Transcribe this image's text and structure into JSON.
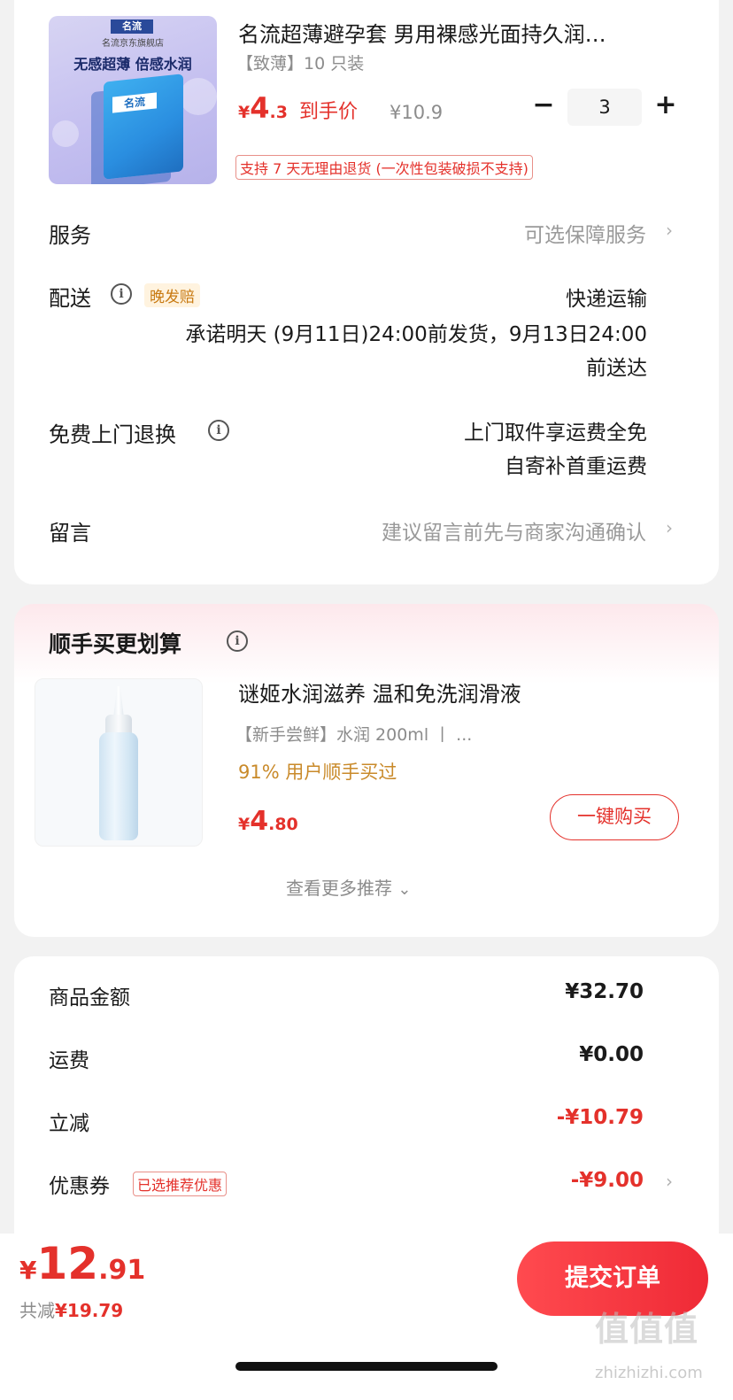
{
  "product": {
    "image_store": "名流京东旗舰店",
    "image_slogan": "无感超薄  倍感水润",
    "image_brand": "名流",
    "title": "名流超薄避孕套 男用裸感光面持久润…",
    "spec": "【致薄】10 只装",
    "price_symbol": "¥",
    "price_int": "4",
    "price_frac": ".3",
    "price_label": "到手价",
    "original_price": "¥10.9",
    "quantity": "3",
    "minus_label": "−",
    "plus_label": "+",
    "return_policy": "支持 7 天无理由退货 (一次性包装破损不支持)"
  },
  "rows": {
    "service_label": "服务",
    "service_value": "可选保障服务",
    "delivery_label": "配送",
    "delivery_badge": "晚发赔",
    "delivery_method": "快递运输",
    "delivery_promise_line1": "承诺明天 (9月11日)24:00前发货，9月13日24:00",
    "delivery_promise_line2": "前送达",
    "return_label": "免费上门退换",
    "return_line1": "上门取件享运费全免",
    "return_line2": "自寄补首重运费",
    "message_label": "留言",
    "message_placeholder": "建议留言前先与商家沟通确认"
  },
  "addon": {
    "section_title": "顺手买更划算",
    "title": "谜姬水润滋养 温和免洗润滑液",
    "spec": "【新手尝鲜】水润 200ml  丨 ...",
    "hint": "91% 用户顺手买过",
    "price_symbol": "¥",
    "price_int": "4",
    "price_frac": ".80",
    "buy_label": "一键购买",
    "more_label": "查看更多推荐",
    "more_chevron": "⌄"
  },
  "summary": {
    "goods_label": "商品金额",
    "goods_value": "¥32.70",
    "shipping_label": "运费",
    "shipping_value": "¥0.00",
    "discount_label": "立减",
    "discount_value": "-¥10.79",
    "coupon_label": "优惠券",
    "coupon_badge": "已选推荐优惠",
    "coupon_value": "-¥9.00"
  },
  "footer": {
    "total_symbol": "¥",
    "total_int": "12",
    "total_frac": ".91",
    "saving_prefix": "共减",
    "saving_value": "¥19.79",
    "submit_label": "提交订单"
  },
  "watermark": {
    "text": "值值值",
    "url": "zhizhizhi.com"
  },
  "icons": {
    "chevron_right": "›",
    "info": "i"
  },
  "colors": {
    "accent_red": "#e4312b",
    "hint_orange": "#c98a2a",
    "late_badge_bg": "#fff3df"
  }
}
